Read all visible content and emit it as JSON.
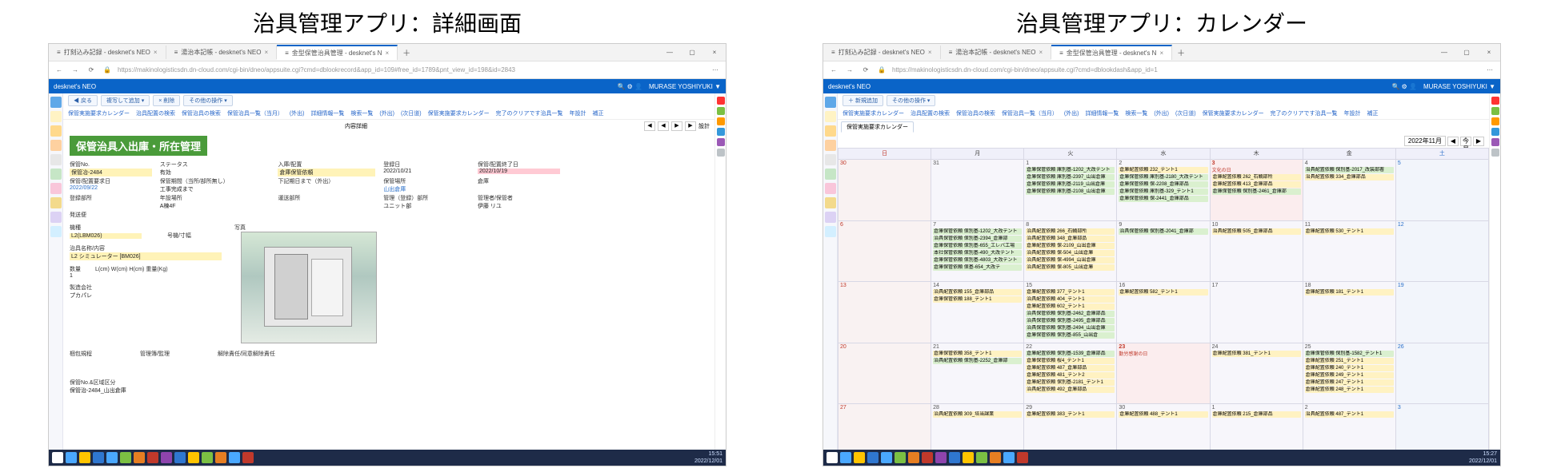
{
  "panelTitles": {
    "left": "治具管理アプリ：詳細画面",
    "right": "治具管理アプリ：カレンダー"
  },
  "browser": {
    "tabs": [
      {
        "icon": "≡",
        "title": "打刻込み記録 - desknet's NEO"
      },
      {
        "icon": "≡",
        "title": "湯治本記帳 - desknet's NEO"
      },
      {
        "icon": "≡",
        "title": "金型保管治具管理 - desknet's N"
      }
    ],
    "url": "https://makinologisticsdn.dn-cloud.com/cgi-bin/dneo/appsuite.cgi?cmd=dblookrecord&app_id=109#free_id=1789&pnt_view_id=198&id=2843"
  },
  "desknet": {
    "appName": "desknet's NEO",
    "user": "MURASE YOSHIYUKI ▼",
    "headerIcons": "🔍 ⚙ 👤"
  },
  "toolbar": {
    "back": "◀ 戻る",
    "addCopy": "複写して追加 ▾",
    "delete": "× 削除",
    "other": "その他の操作 ▾"
  },
  "navLinks": [
    "保管実施要求カレンダー",
    "治具配置の検索",
    "保管治具の検索",
    "保管治具一覧（当月）",
    "(外出)",
    "詳細情報一覧",
    "検索一覧",
    "(外出)",
    "(次日道)",
    "保管実施要求カレンダー",
    "完了のクリアです治具一覧",
    "年設計",
    "補正"
  ],
  "detailBar": {
    "pageCount": "内容詳細",
    "pager": [
      "◀",
      "◀",
      "▶",
      "▶"
    ],
    "pos": "設計"
  },
  "greenTitle": "保管治具入出庫・所在管理",
  "fields": {
    "r1": {
      "c1l": "保管No.",
      "c1v": "保管冶-2484",
      "c2l": "ステータス",
      "c2v": "有効",
      "c3l": "入庫/配置",
      "c3v": "倉庫保管依頼",
      "c4l": "登録日",
      "c4v": "2022/10/21",
      "c5l": "保管/配置終了日",
      "c5v": "2022/10/19"
    },
    "r2": {
      "c1l": "保管/配置要求日",
      "c1v": "2022/09/22",
      "c2l": "保管期間（当所/部所無し）",
      "c2v": "工事完成まで",
      "c3l": "下記期日まで（外出）",
      "c3v": "",
      "c4l": "保管場所",
      "c4v": "山出倉庫",
      "c5l": "倉庫",
      "c5v": ""
    },
    "r3": {
      "c1l": "登録部所",
      "c1v": "",
      "c2l": "年設場所",
      "c2v": "A棟4F",
      "c3l": "運送部所",
      "c3v": "",
      "c4l": "管理（登録）部所",
      "c4v": "ユニット部",
      "c5l": "管理者/保管者",
      "c5v": "伊藤 リユ"
    },
    "r4": {
      "c1l": "発送便",
      "c1v": ""
    }
  },
  "block2": {
    "kishu_l": "機種",
    "kishu_v": "L2(LBM026)",
    "goki_l": "号機/寸幅",
    "goki_v": "",
    "name_l": "治具名称/内容",
    "name_v": "L2 シミュレーター [BM026]",
    "qty_l": "数量",
    "qty_v": "1",
    "dims_l": "L(cm)  W(cm)  H(cm)  重量(Kg)",
    "mfg_l": "製造会社",
    "mfg_v": "プカパレ",
    "photo_l": "写真"
  },
  "block3": {
    "release_l": "梱包規程",
    "mgmt_l": "管理簿/監理",
    "csv_l": "解除責任/同意解除責任"
  },
  "remarks": {
    "l": "保管No.&区域区分",
    "v": "保管治-2484_山出倉庫"
  },
  "taskbarTime": {
    "t": "15:51",
    "d": "2022/12/01"
  },
  "calBrowser": {
    "url": "https://makinologisticsdn.dn-cloud.com/cgi-bin/dneo/appsuite.cgi?cmd=dblookdash&app_id=1"
  },
  "calToolbar": {
    "add": "＋ 新規追加",
    "other": "その他の操作 ▾"
  },
  "calTabs": {
    "active": "保管実施要求カレンダー"
  },
  "monthLabel": "2022年11月",
  "todayBtn": "今月",
  "dow": [
    "日",
    "月",
    "火",
    "水",
    "木",
    "金",
    "土"
  ],
  "weeks": [
    [
      {
        "d": "30",
        "cls": "sun"
      },
      {
        "d": "31"
      },
      {
        "d": "1",
        "ev": [
          [
            "g",
            "倉庫保管依頼 庫別基-1202_大改テント"
          ],
          [
            "g",
            "倉庫保管依頼 庫別基-2397_山出倉庫"
          ],
          [
            "g",
            "倉庫保管依頼 庫別基-2119_山出倉庫"
          ],
          [
            "g",
            "倉庫保管依頼 庫別基-2108_山出倉庫"
          ]
        ]
      },
      {
        "d": "2",
        "ev": [
          [
            "y",
            "倉庫配置依頼 232_テント1"
          ],
          [
            "g",
            "倉庫保管依頼 庫別基-2180_大改テント"
          ],
          [
            "g",
            "倉庫保管依頼 保-2208_倉庫部品"
          ],
          [
            "g",
            "倉庫保管依頼 庫別基-329_テント1"
          ],
          [
            "g",
            "倉庫保管依頼 保-2441_倉庫部品"
          ]
        ]
      },
      {
        "d": "3",
        "hol": "文化の日",
        "cls": "hol",
        "ev": [
          [
            "y",
            "倉庫配置依頼 262_石輌部所"
          ],
          [
            "y",
            "倉庫配置依頼 413_倉庫部品"
          ],
          [
            "g",
            "倉庫保管依頼 保別基-2461_倉庫部"
          ]
        ]
      },
      {
        "d": "4",
        "ev": [
          [
            "g",
            "治具配置依頼 保別基-2017_改装部署"
          ],
          [
            "y",
            "治具配置依頼 334_倉庫部品"
          ]
        ]
      },
      {
        "d": "5",
        "cls": "sat"
      }
    ],
    [
      {
        "d": "6",
        "cls": "sun"
      },
      {
        "d": "7",
        "ev": [
          [
            "g",
            "倉庫保管依頼 保別基-1202_大改テント"
          ],
          [
            "g",
            "治具保管依頼 保別基-2394_倉庫部"
          ],
          [
            "g",
            "倉庫保管依頼 保別基-655_エレバ工場"
          ],
          [
            "g",
            "本社保管依頼 保別基-490_大改テント"
          ],
          [
            "g",
            "倉庫保管依頼 保別基-4803_大改テント"
          ],
          [
            "g",
            "倉庫保管依頼 保基-654_大改テ"
          ]
        ]
      },
      {
        "d": "8",
        "ev": [
          [
            "y",
            "治具配置依頼 266_石輌部所"
          ],
          [
            "y",
            "治具配置依頼 348_倉庫部品"
          ],
          [
            "y",
            "倉庫配置依頼 保-2109_山出倉庫"
          ],
          [
            "y",
            "治具配置依頼 保-504_山出倉庫"
          ],
          [
            "y",
            "治具配置依頼 保-4994_山出倉庫"
          ],
          [
            "y",
            "治具配置依頼 保-805_山出倉庫"
          ]
        ]
      },
      {
        "d": "9",
        "ev": [
          [
            "g",
            "治具保管依頼 保別基-2041_倉庫部"
          ]
        ]
      },
      {
        "d": "10",
        "ev": [
          [
            "y",
            "治具配置依頼 505_倉庫部品"
          ]
        ]
      },
      {
        "d": "11",
        "ev": [
          [
            "y",
            "倉庫配置依頼 530_テント1"
          ]
        ]
      },
      {
        "d": "12",
        "cls": "sat"
      }
    ],
    [
      {
        "d": "13",
        "cls": "sun"
      },
      {
        "d": "14",
        "ev": [
          [
            "y",
            "治具配置依頼 155_倉庫部品"
          ],
          [
            "y",
            "倉庫保管依頼 188_テント1"
          ]
        ]
      },
      {
        "d": "15",
        "ev": [
          [
            "y",
            "倉庫配置依頼 377_テント1"
          ],
          [
            "y",
            "治具配置依頼 404_テント1"
          ],
          [
            "y",
            "倉庫配置依頼 602_テント1"
          ],
          [
            "g",
            "治具保管依頼 保別基-2462_倉庫部品"
          ],
          [
            "g",
            "治具保管依頼 保別基-2495_倉庫部品"
          ],
          [
            "g",
            "治具保管依頼 保別基-2494_山出倉庫"
          ],
          [
            "g",
            "倉庫保管依頼 保別基-855_山出倉"
          ]
        ]
      },
      {
        "d": "16",
        "ev": [
          [
            "y",
            "倉庫配置依頼 582_テント1"
          ]
        ]
      },
      {
        "d": "17"
      },
      {
        "d": "18",
        "ev": [
          [
            "y",
            "倉庫配置依頼 181_テント1"
          ]
        ]
      },
      {
        "d": "19",
        "cls": "sat"
      }
    ],
    [
      {
        "d": "20",
        "cls": "sun"
      },
      {
        "d": "21",
        "ev": [
          [
            "y",
            "倉庫保管依頼 358_テント1"
          ],
          [
            "g",
            "治具配置依頼 保別基-2252_倉庫部"
          ]
        ]
      },
      {
        "d": "22",
        "ev": [
          [
            "g",
            "倉庫配置依頼 保別基-1539_倉庫部品"
          ],
          [
            "y",
            "倉庫保管依頼 桜4_テント1"
          ],
          [
            "y",
            "倉庫配置依頼 487_倉庫部品"
          ],
          [
            "y",
            "倉庫配置依頼 481_テント2"
          ],
          [
            "y",
            "倉庫配置依頼 保別基-2181_テント1"
          ],
          [
            "y",
            "治具配置依頼 492_倉庫部品"
          ]
        ]
      },
      {
        "d": "23",
        "hol": "勤労感謝の日",
        "cls": "hol"
      },
      {
        "d": "24",
        "ev": [
          [
            "y",
            "倉庫配置依頼 381_テント1"
          ]
        ]
      },
      {
        "d": "25",
        "ev": [
          [
            "g",
            "倉庫保管依頼 保別基-1582_テント1"
          ],
          [
            "y",
            "倉庫配置依頼 251_テント1"
          ],
          [
            "y",
            "倉庫配置依頼 240_テント1"
          ],
          [
            "y",
            "倉庫配置依頼 249_テント1"
          ],
          [
            "y",
            "倉庫配置依頼 247_テント1"
          ],
          [
            "y",
            "倉庫配置依頼 248_テント1"
          ]
        ]
      },
      {
        "d": "26",
        "cls": "sat"
      }
    ],
    [
      {
        "d": "27",
        "cls": "sun"
      },
      {
        "d": "28",
        "ev": [
          [
            "y",
            "治具配置依頼 309_培当課業"
          ]
        ]
      },
      {
        "d": "29",
        "ev": [
          [
            "y",
            "倉庫配置依頼 383_テント1"
          ]
        ]
      },
      {
        "d": "30",
        "ev": [
          [
            "y",
            "倉庫配置依頼 488_テント1"
          ]
        ]
      },
      {
        "d": "1",
        "ev": [
          [
            "y",
            "倉庫配置依頼 215_倉庫部品"
          ]
        ]
      },
      {
        "d": "2",
        "ev": [
          [
            "y",
            "治具配置依頼 487_テント1"
          ]
        ]
      },
      {
        "d": "3",
        "cls": "sat"
      }
    ]
  ],
  "taskbarTimeR": {
    "t": "15:27",
    "d": "2022/12/01"
  }
}
